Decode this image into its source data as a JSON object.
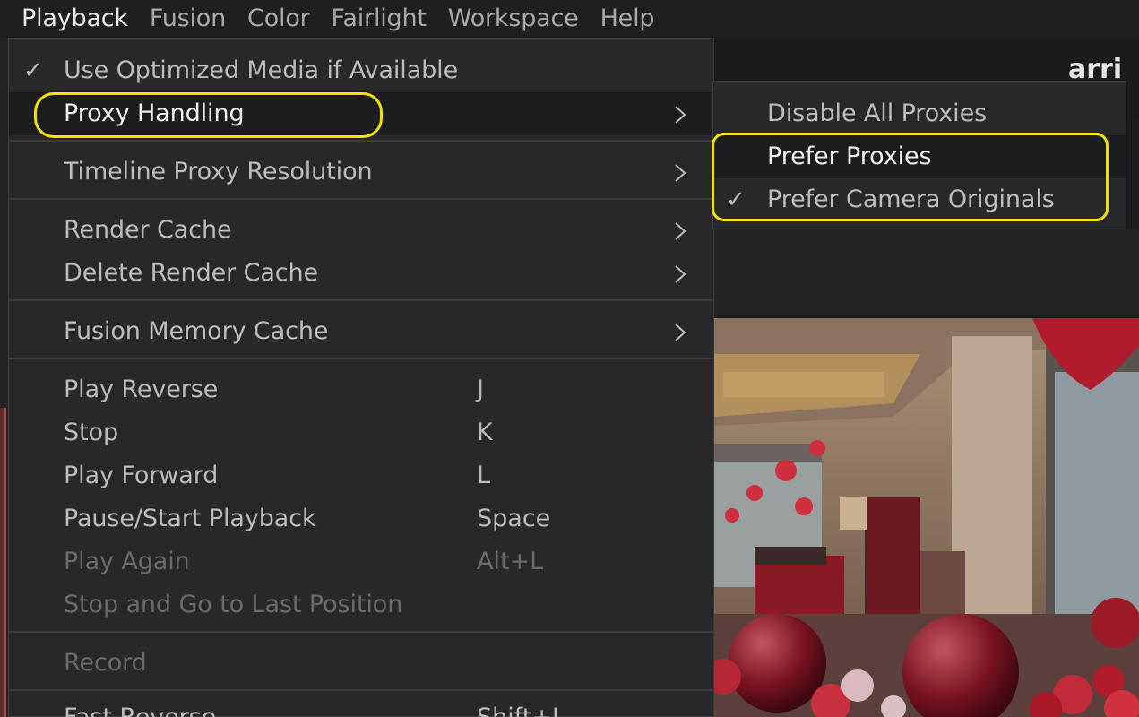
{
  "menubar": {
    "items": [
      "Playback",
      "Fusion",
      "Color",
      "Fairlight",
      "Workspace",
      "Help"
    ]
  },
  "background": {
    "title_fragment": "arri"
  },
  "playback_menu": {
    "items": [
      {
        "label": "Use Optimized Media if Available",
        "checked": true
      },
      {
        "label": "Proxy Handling",
        "submenu": true,
        "highlighted": true
      },
      {
        "label": "Timeline Proxy Resolution",
        "submenu": true
      },
      {
        "label": "Render Cache",
        "submenu": true
      },
      {
        "label": "Delete Render Cache",
        "submenu": true
      },
      {
        "label": "Fusion Memory Cache",
        "submenu": true
      },
      {
        "label": "Play Reverse",
        "shortcut": "J"
      },
      {
        "label": "Stop",
        "shortcut": "K"
      },
      {
        "label": "Play Forward",
        "shortcut": "L"
      },
      {
        "label": "Pause/Start Playback",
        "shortcut": "Space"
      },
      {
        "label": "Play Again",
        "shortcut": "Alt+L",
        "disabled": true
      },
      {
        "label": "Stop and Go to Last Position",
        "disabled": true
      },
      {
        "label": "Record",
        "disabled": true
      },
      {
        "label": "Fast Reverse",
        "shortcut": "Shift+J"
      }
    ]
  },
  "proxy_submenu": {
    "items": [
      {
        "label": "Disable All Proxies"
      },
      {
        "label": "Prefer Proxies",
        "hover": true
      },
      {
        "label": "Prefer Camera Originals",
        "checked": true
      }
    ]
  },
  "icons": {
    "check": "checkmark-icon",
    "submenu_arrow": "chevron-right-icon"
  },
  "colors": {
    "annotation": "#f2e200",
    "menu_bg": "#28282a"
  }
}
